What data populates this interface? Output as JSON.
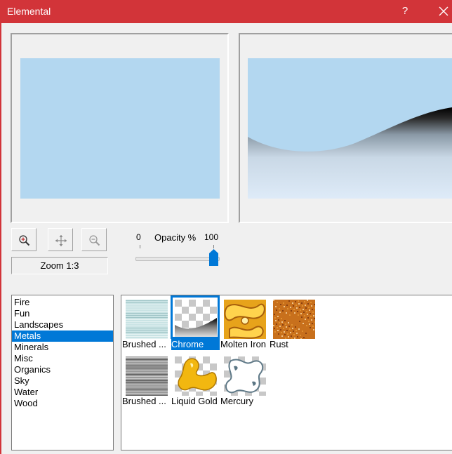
{
  "window": {
    "title": "Elemental",
    "help_label": "?"
  },
  "preview": {
    "zoom_label": "Zoom 1:3",
    "canvas_color": "#b3d7f0"
  },
  "opacity": {
    "label": "Opacity %",
    "min_label": "0",
    "max_label": "100",
    "value": 100
  },
  "categories": [
    {
      "label": "Fire",
      "selected": false
    },
    {
      "label": "Fun",
      "selected": false
    },
    {
      "label": "Landscapes",
      "selected": false
    },
    {
      "label": "Metals",
      "selected": true
    },
    {
      "label": "Minerals",
      "selected": false
    },
    {
      "label": "Misc",
      "selected": false
    },
    {
      "label": "Organics",
      "selected": false
    },
    {
      "label": "Sky",
      "selected": false
    },
    {
      "label": "Water",
      "selected": false
    },
    {
      "label": "Wood",
      "selected": false
    }
  ],
  "swatches": [
    {
      "label": "Brushed ...",
      "selected": false,
      "icon": "brushed-metal-light"
    },
    {
      "label": "Chrome",
      "selected": true,
      "icon": "chrome"
    },
    {
      "label": "Molten Iron",
      "selected": false,
      "icon": "molten-iron"
    },
    {
      "label": "Rust",
      "selected": false,
      "icon": "rust"
    },
    {
      "label": "Brushed ...",
      "selected": false,
      "icon": "brushed-metal-dark"
    },
    {
      "label": "Liquid Gold",
      "selected": false,
      "icon": "liquid-gold"
    },
    {
      "label": "Mercury",
      "selected": false,
      "icon": "mercury"
    }
  ],
  "colors": {
    "titlebar": "#d23439",
    "accent": "#0078d7"
  }
}
